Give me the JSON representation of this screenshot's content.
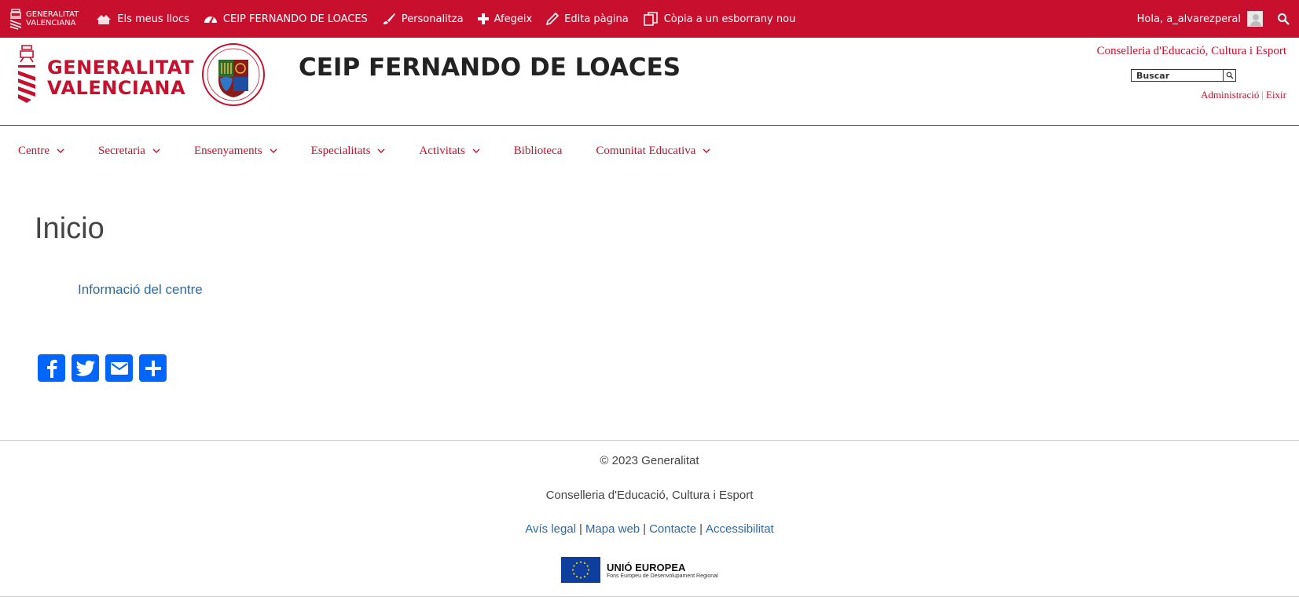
{
  "adminbar": {
    "logo_line1": "GENERALITAT",
    "logo_line2": "VALENCIANA",
    "items": [
      {
        "label": "Els meus llocs",
        "icon": "my-sites-icon"
      },
      {
        "label": "CEIP FERNANDO DE LOACES",
        "icon": "dashboard-icon"
      },
      {
        "label": "Personalitza",
        "icon": "brush-icon"
      },
      {
        "label": "Afegeix",
        "icon": "plus-icon"
      },
      {
        "label": "Edita pàgina",
        "icon": "pencil-icon"
      },
      {
        "label": "Còpia a un esborrany nou",
        "icon": "copy-icon"
      }
    ],
    "greeting": "Hola, a_alvarezperal",
    "color": "#c8102e"
  },
  "header": {
    "gva_line1": "GENERALITAT",
    "gva_line2": "VALENCIANA",
    "site_title": "CEIP FERNANDO DE LOACES",
    "conselleria": "Conselleria d'Educació, Cultura i Esport",
    "search_value": "Buscar",
    "admin_link": "Administració",
    "admin_sep": "|",
    "exit_link": "Eixir"
  },
  "nav": {
    "items": [
      {
        "label": "Centre",
        "dropdown": true
      },
      {
        "label": "Secretaria",
        "dropdown": true
      },
      {
        "label": "Ensenyaments",
        "dropdown": true
      },
      {
        "label": "Especialitats",
        "dropdown": true
      },
      {
        "label": "Activitats",
        "dropdown": true
      },
      {
        "label": "Biblioteca",
        "dropdown": false
      },
      {
        "label": "Comunitat Educativa",
        "dropdown": true
      }
    ]
  },
  "main": {
    "title": "Inicio",
    "link": "Informació del centre",
    "share": [
      "facebook-icon",
      "twitter-icon",
      "email-icon",
      "plus-icon"
    ]
  },
  "footer": {
    "copyright": "© 2023 Generalitat",
    "conselleria": "Conselleria d'Educació, Cultura i Esport",
    "links": [
      "Avís legal",
      "Mapa web",
      "Contacte",
      "Accessibilitat"
    ],
    "sep": "|",
    "eu_title": "UNIÓ EUROPEA",
    "eu_subtitle": "Fons Europeu de Desenvolupament Regional"
  }
}
